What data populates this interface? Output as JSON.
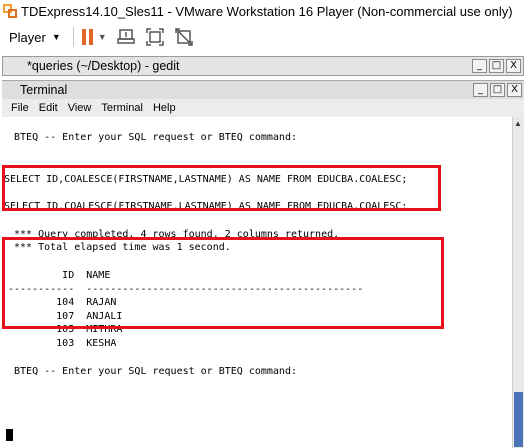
{
  "vm": {
    "title": "TDExpress14.10_Sles11 - VMware Workstation 16 Player (Non-commercial use only)",
    "player_menu": "Player"
  },
  "gedit": {
    "title": "*queries (~/Desktop) - gedit",
    "buttons": [
      "_",
      "□",
      "X"
    ]
  },
  "terminal": {
    "title": "Terminal",
    "menu": [
      "File",
      "Edit",
      "View",
      "Terminal",
      "Help"
    ],
    "buttons": [
      "_",
      "□",
      "X"
    ],
    "lines": [
      " BTEQ -- Enter your SQL request or BTEQ command:",
      "SELECT ID,COALESCE(FIRSTNAME,LASTNAME) AS NAME FROM EDUCBA.COALESC;",
      "SELECT ID,COALESCE(FIRSTNAME,LASTNAME) AS NAME FROM EDUCBA.COALESC;",
      " *** Query completed. 4 rows found. 2 columns returned.",
      " *** Total elapsed time was 1 second.",
      "         ID  NAME",
      "-----------  ----------------------------------------------",
      "        104  RAJAN",
      "        107  ANJALI",
      "        105  MITHRA",
      "        103  KESHA",
      " BTEQ -- Enter your SQL request or BTEQ command:"
    ]
  },
  "colors": {
    "highlight": "#e8101a",
    "pause": "#e2672a",
    "scroll_thumb": "#4a73b8"
  }
}
